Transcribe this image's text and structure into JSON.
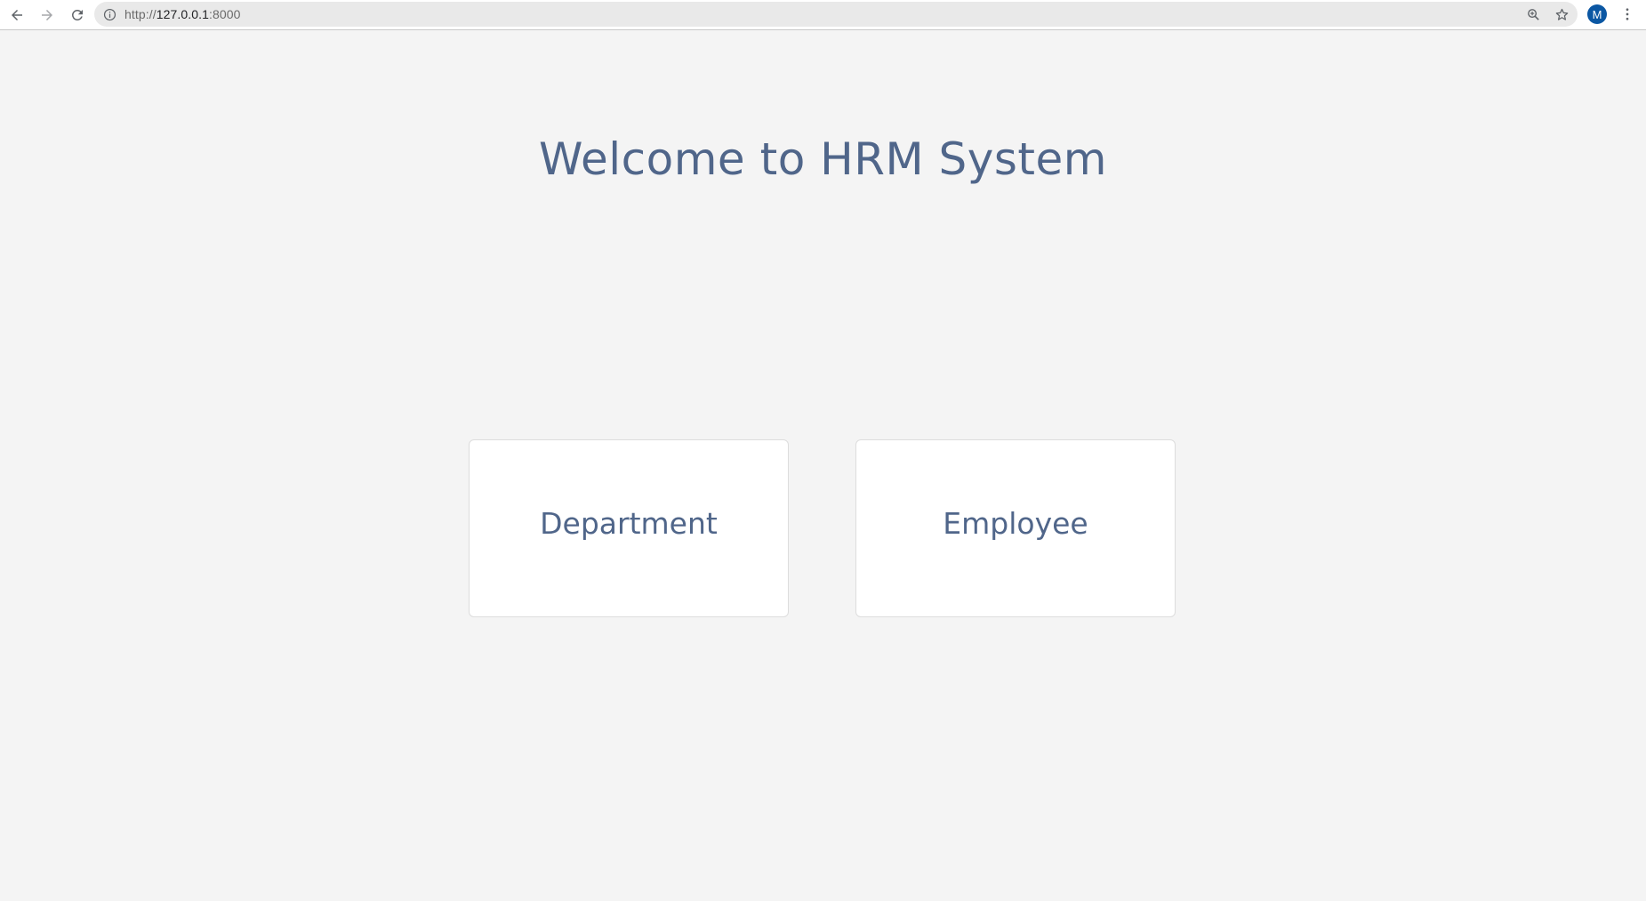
{
  "browser": {
    "url_scheme": "http://",
    "url_host": "127.0.0.1",
    "url_port": ":8000",
    "avatar_letter": "M",
    "icons": [
      "back-arrow-icon",
      "forward-arrow-icon",
      "reload-icon",
      "info-icon",
      "zoom-icon",
      "star-icon",
      "menu-dots-icon"
    ],
    "avatar_color": "#0b57a3"
  },
  "page": {
    "title": "Welcome to HRM System",
    "cards": [
      {
        "label": "Department"
      },
      {
        "label": "Employee"
      }
    ],
    "text_color": "#50668a",
    "background_color": "#f4f4f4"
  }
}
